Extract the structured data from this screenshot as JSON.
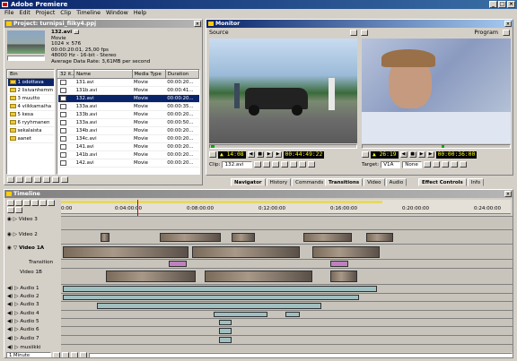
{
  "app": {
    "title": "Adobe Premiere",
    "menu": [
      "File",
      "Edit",
      "Project",
      "Clip",
      "Timeline",
      "Window",
      "Help"
    ]
  },
  "project": {
    "title": "Project: turnipsi_fiiky4.ppj",
    "preview": {
      "name": "132.avi",
      "lines": [
        "Movie",
        "1024 × 576",
        "00:00:20:01, 25,00 fps",
        "48000 Hz - 16-bit - Stereo",
        "Average Data Rate: 3,61MB per second"
      ]
    },
    "bin_header": "Bin",
    "bins": [
      "1 odottava",
      "2 lisivanhemm",
      "3 muutto",
      "4 viikkamaiha",
      "5 kesa",
      "6 ryyhmanen",
      "sekalaista",
      "aanet"
    ],
    "columns": [
      "32 it...",
      "Name",
      "Media Type",
      "Duration"
    ],
    "files": [
      {
        "name": "131.avi",
        "type": "Movie",
        "dur": "00:00:20..."
      },
      {
        "name": "131b.avi",
        "type": "Movie",
        "dur": "00:00:41..."
      },
      {
        "name": "132.avi",
        "type": "Movie",
        "dur": "00:00:20..."
      },
      {
        "name": "133a.avi",
        "type": "Movie",
        "dur": "00:00:35..."
      },
      {
        "name": "133b.avi",
        "type": "Movie",
        "dur": "00:00:20..."
      },
      {
        "name": "133a.avi",
        "type": "Movie",
        "dur": "00:00:50..."
      },
      {
        "name": "134b.avi",
        "type": "Movie",
        "dur": "00:00:20..."
      },
      {
        "name": "134c.avi",
        "type": "Movie",
        "dur": "00:00:20..."
      },
      {
        "name": "141.avi",
        "type": "Movie",
        "dur": "00:00:20..."
      },
      {
        "name": "141b.avi",
        "type": "Movie",
        "dur": "00:00:20..."
      },
      {
        "name": "142.avi",
        "type": "Movie",
        "dur": "00:00:20..."
      }
    ]
  },
  "monitor": {
    "title": "Monitor",
    "source_label": "Source",
    "program_label": "Program",
    "source_in": "14:08",
    "source_dur": "00:44:49:22",
    "program_in": "26:19",
    "program_dur": "00:00:36:00",
    "clip_label": "Clip:",
    "clip_value": "132.avi",
    "target_label": "Target:",
    "target_value": "V1A",
    "none_value": "None"
  },
  "palette_tabs": {
    "group1": [
      "Navigator",
      "History",
      "Commands"
    ],
    "group2": [
      "Transitions",
      "Video",
      "Audio"
    ],
    "group3": [
      "Effect Controls",
      "Info"
    ]
  },
  "timeline": {
    "title": "Timeline",
    "ruler": [
      "0:00",
      "0:04:00:00",
      "0:08:00:00",
      "0:12:00:00",
      "0:16:00:00",
      "0:20:00:00",
      "0:24:00:00"
    ],
    "tracks": [
      "Video 3",
      "Video 2",
      "Video 1A",
      "Transition",
      "Video 1B",
      "Audio 1",
      "Audio 2",
      "Audio 3",
      "Audio 4",
      "Audio 5",
      "Audio 6",
      "Audio 7",
      "musiikki"
    ],
    "zoom": "1 Minute"
  }
}
